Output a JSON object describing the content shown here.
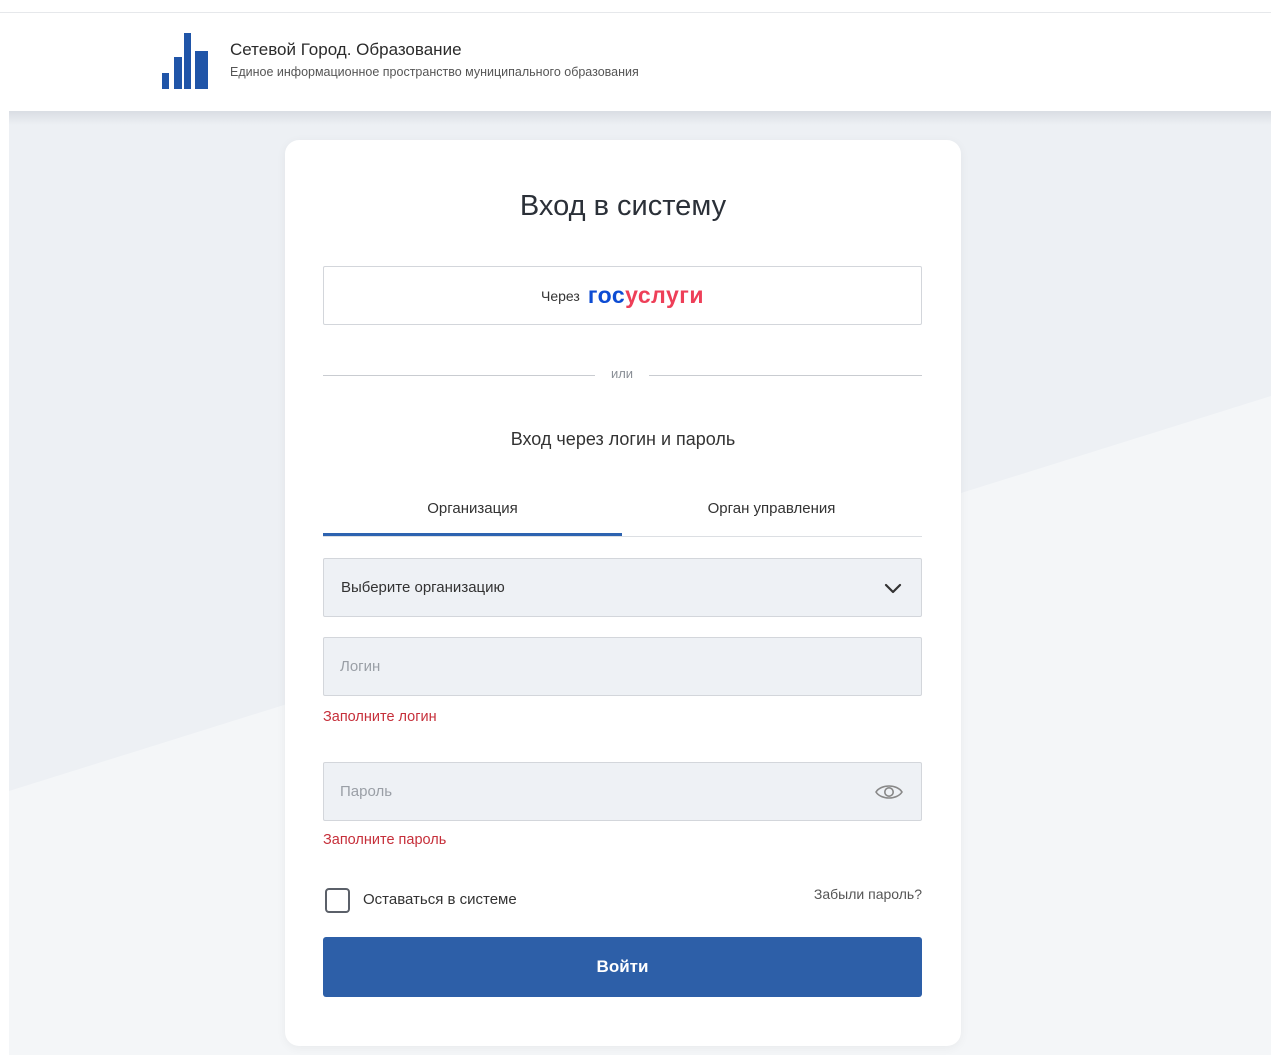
{
  "header": {
    "title": "Сетевой Город. Образование",
    "subtitle": "Единое информационное пространство муниципального образования"
  },
  "login": {
    "title": "Вход в систему",
    "gosuslugi": {
      "prefix": "Через",
      "logo_part1": "гос",
      "logo_part2": "услуги"
    },
    "divider": "или",
    "subtitle": "Вход через логин и пароль",
    "tabs": [
      {
        "label": "Организация",
        "active": true
      },
      {
        "label": "Орган управления",
        "active": false
      }
    ],
    "org_select": {
      "value": "Выберите организацию"
    },
    "login_field": {
      "placeholder": "Логин",
      "value": "",
      "error": "Заполните логин"
    },
    "password_field": {
      "placeholder": "Пароль",
      "value": "",
      "error": "Заполните пароль"
    },
    "remember": {
      "label": "Оставаться в системе",
      "checked": false
    },
    "forgot": "Забыли пароль?",
    "submit": "Войти"
  },
  "colors": {
    "accent": "#2d5fa8",
    "error": "#c62f3a",
    "gos_blue": "#0d4cd3",
    "gos_red": "#ee3f58"
  }
}
